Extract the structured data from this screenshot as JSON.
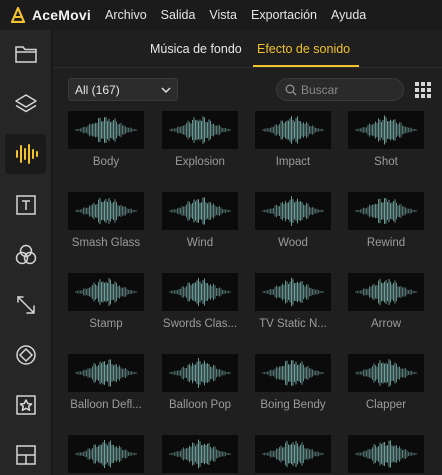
{
  "app": {
    "name": "AceMovi",
    "brand_color": "#f2c22f"
  },
  "menu": [
    "Archivo",
    "Salida",
    "Vista",
    "Exportación",
    "Ayuda"
  ],
  "sidebar": {
    "items": [
      {
        "icon": "folder-icon",
        "active": false
      },
      {
        "icon": "layers-icon",
        "active": false
      },
      {
        "icon": "audio-waveform-icon",
        "active": true
      },
      {
        "icon": "text-icon",
        "active": false
      },
      {
        "icon": "filters-icon",
        "active": false
      },
      {
        "icon": "transitions-icon",
        "active": false
      },
      {
        "icon": "effects-icon",
        "active": false
      },
      {
        "icon": "elements-icon",
        "active": false
      },
      {
        "icon": "split-screen-icon",
        "active": false
      }
    ]
  },
  "tabs": [
    {
      "label": "Música de fondo",
      "active": false
    },
    {
      "label": "Efecto de sonido",
      "active": true
    }
  ],
  "filter": {
    "selected": "All (167)"
  },
  "search": {
    "placeholder": "Buscar",
    "value": ""
  },
  "sounds": [
    "Body",
    "Explosion",
    "Impact",
    "Shot",
    "Smash Glass",
    "Wind",
    "Wood",
    "Rewind",
    "Stamp",
    "Swords Clas...",
    "TV Static N...",
    "Arrow",
    "Balloon Defl...",
    "Balloon Pop",
    "Boing Bendy",
    "Clapper",
    "",
    "",
    "",
    ""
  ],
  "colors": {
    "waveform": "#6f9e9a",
    "thumb_bg": "#0b0b0b",
    "active_tab": "#f2c22f"
  }
}
